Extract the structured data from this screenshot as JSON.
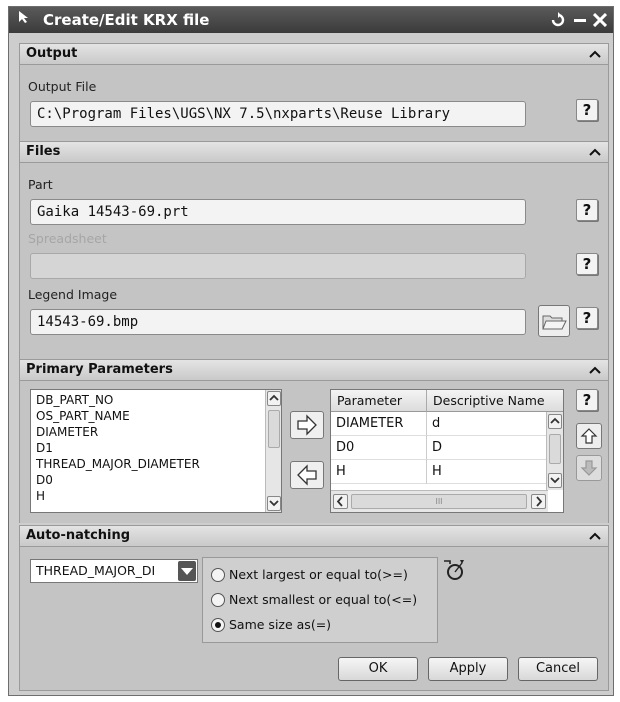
{
  "window": {
    "title": "Create/Edit KRX file"
  },
  "output": {
    "section_title": "Output",
    "output_file_label": "Output File",
    "output_file_value": "C:\\Program Files\\UGS\\NX 7.5\\nxparts\\Reuse Library"
  },
  "files": {
    "section_title": "Files",
    "part_label": "Part",
    "part_value": "Gaika 14543-69.prt",
    "spreadsheet_label": "Spreadsheet",
    "spreadsheet_value": "",
    "legend_label": "Legend Image",
    "legend_value": "14543-69.bmp"
  },
  "primary": {
    "section_title": "Primary Parameters",
    "list_items": [
      "DB_PART_NO",
      "OS_PART_NAME",
      "DIAMETER",
      "D1",
      "THREAD_MAJOR_DIAMETER",
      "D0",
      "H"
    ],
    "table_headers": [
      "Parameter",
      "Descriptive Name"
    ],
    "table_rows": [
      {
        "parameter": "DIAMETER",
        "name": "d"
      },
      {
        "parameter": "D0",
        "name": "D"
      },
      {
        "parameter": "H",
        "name": "H"
      }
    ],
    "scrollbar_grip": "III"
  },
  "automatching": {
    "section_title": "Auto-natching",
    "select_value": "THREAD_MAJOR_DI",
    "options": [
      "Next largest or equal to(>=)",
      "Next smallest or equal to(<=)",
      "Same size as(=)"
    ],
    "selected_option": 2
  },
  "footer": {
    "ok": "OK",
    "apply": "Apply",
    "cancel": "Cancel"
  },
  "help_glyph": "?",
  "icons": [
    "cursor-icon",
    "reset-icon",
    "minimize-icon",
    "close-icon",
    "collapse-icon",
    "help-icon",
    "folder-icon",
    "add-right-arrow-icon",
    "remove-left-arrow-icon",
    "move-up-icon",
    "move-down-icon",
    "filter-icon"
  ]
}
